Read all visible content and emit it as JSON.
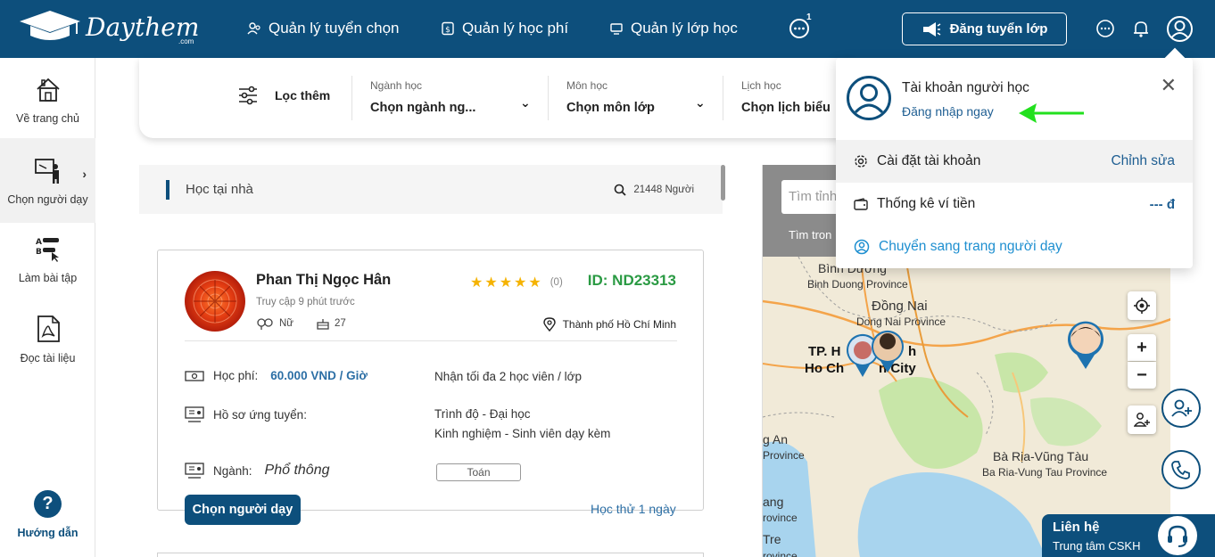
{
  "brand": {
    "name": "Daythem",
    "suffix": ".com"
  },
  "nav": {
    "items": [
      "Quản lý tuyển chọn",
      "Quản lý học phí",
      "Quản lý lớp học"
    ],
    "chat_badge": "1",
    "post_button": "Đăng tuyển lớp"
  },
  "sidebar": {
    "items": [
      "Về trang chủ",
      "Chọn người dạy",
      "Làm bài tập",
      "Đọc tài liệu"
    ],
    "guide": "Hướng dẫn",
    "guide_icon": "?"
  },
  "filter": {
    "label": "Lọc thêm",
    "groups": [
      {
        "label": "Ngành học",
        "value": "Chọn ngành ng..."
      },
      {
        "label": "Môn học",
        "value": "Chọn môn lớp"
      },
      {
        "label": "Lịch học",
        "value": "Chọn lịch biểu"
      }
    ]
  },
  "search": {
    "title": "Học tại nhà",
    "count": "21448 Người"
  },
  "tutor": {
    "name": "Phan Thị Ngọc Hân",
    "last_access": "Truy cập 9 phút trước",
    "gender": "Nữ",
    "age": "27",
    "rating": 5,
    "rating_count": "(0)",
    "id": "ID: ND23313",
    "city": "Thành phố Hồ Chí Minh",
    "fee_label": "Học phí:",
    "fee": "60.000 VND / Giờ",
    "capacity": "Nhận tối đa 2 học viên / lớp",
    "profile_label": "Hồ sơ ứng tuyển:",
    "level": "Trình độ - Đại học",
    "experience": "Kinh nghiệm - Sinh viên dạy kèm",
    "major_label": "Ngành:",
    "major": "Phổ thông",
    "subject": "Toán",
    "choose_button": "Chọn người dạy",
    "trial": "Học thử 1 ngày"
  },
  "map": {
    "search_placeholder": "Tìm tỉnh",
    "hint": "Tìm tron",
    "labels": [
      "Bình Dương",
      "Binh Duong Province",
      "Đồng Nai",
      "Dong Nai Province",
      "TP. H",
      "h",
      "Ho Ch",
      "n City",
      "g An",
      "Province",
      "Bà Rịa-Vũng Tàu",
      "Ba Ria-Vung Tau Province",
      "ang",
      "rovince",
      "Tre",
      "rovince"
    ],
    "zoom_in": "+",
    "zoom_out": "−"
  },
  "contact": {
    "title": "Liên hệ",
    "subtitle": "Trung tâm CSKH"
  },
  "account": {
    "title": "Tài khoản người học",
    "login": "Đăng nhập ngay",
    "close": "✕",
    "settings": "Cài đặt tài khoản",
    "edit": "Chỉnh sửa",
    "wallet": "Thống kê ví tiền",
    "wallet_value": "--- đ",
    "switch": "Chuyển sang trang người dạy"
  },
  "colors": {
    "primary": "#0d4f7c",
    "accent_green": "#2a9a43",
    "link": "#1e5e92",
    "star": "#f5b301"
  }
}
